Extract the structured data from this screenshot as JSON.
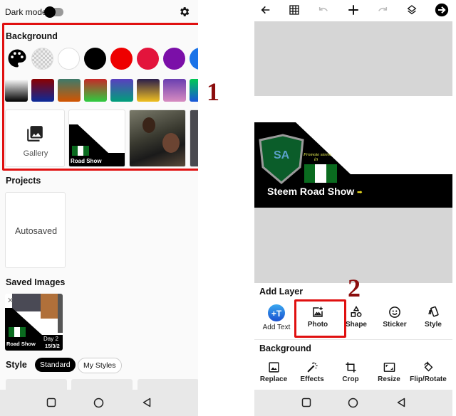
{
  "left": {
    "dark_mode_label": "Dark mode",
    "dark_mode_on": false,
    "background": {
      "title": "Background",
      "colors": [
        "palette",
        "transparent",
        "#ffffff",
        "#000000",
        "#ee0000",
        "#e3143c",
        "#7b0fa8",
        "#1a73e8"
      ],
      "gradients": [
        [
          "#ffffff",
          "#000000"
        ],
        [
          "#8b0000",
          "#0b2a9a"
        ],
        [
          "#3d7a6a",
          "#d35400"
        ],
        [
          "#c62828",
          "#2ecc40"
        ],
        [
          "#5a3fbf",
          "#00a07a"
        ],
        [
          "#2b1d4b",
          "#f0c020"
        ],
        [
          "#6a3fb0",
          "#d88cc0"
        ],
        [
          "#00c853",
          "#1a56db"
        ]
      ],
      "gallery_label": "Gallery",
      "thumb_caption": "Road Show"
    },
    "projects": {
      "title": "Projects",
      "autosaved_label": "Autosaved"
    },
    "saved_images": {
      "title": "Saved Images",
      "caption": "Road Show",
      "day": "Day 2",
      "date": "15/3/2"
    },
    "style": {
      "title": "Style",
      "tabs": [
        "Standard",
        "My Styles"
      ],
      "selected": "Standard"
    }
  },
  "right": {
    "banner": {
      "title": "Steem Road Show",
      "promo": "Promote steem",
      "promo2": "in",
      "logo": "SA"
    },
    "add_layer": {
      "title": "Add Layer",
      "tools": [
        "Add Text",
        "Photo",
        "Shape",
        "Sticker",
        "Style"
      ]
    },
    "background": {
      "title": "Background",
      "tools": [
        "Replace",
        "Effects",
        "Crop",
        "Resize",
        "Flip/Rotate"
      ]
    }
  },
  "annotations": [
    "1",
    "2"
  ],
  "colors": {
    "highlight": "#e01010",
    "annotation": "#8b0d0d"
  }
}
